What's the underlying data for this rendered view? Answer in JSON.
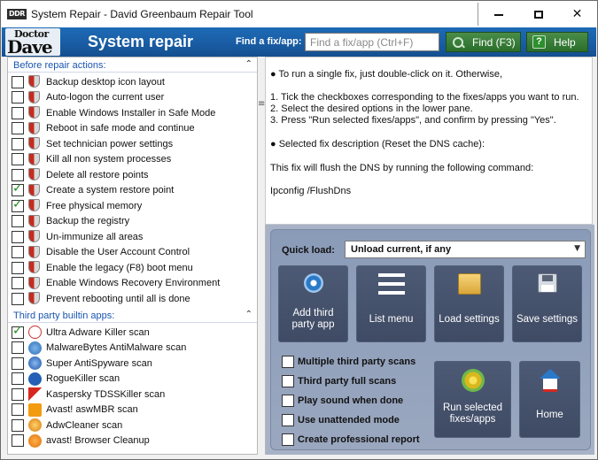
{
  "window": {
    "title": "System Repair - David Greenbaum Repair Tool",
    "icon_text": "DDR",
    "controls": {
      "minimize_icon": "minimize-icon",
      "maximize_icon": "maximize-icon",
      "close_glyph": "✕"
    }
  },
  "header": {
    "logo_top": "Doctor",
    "logo_bottom": "Dave",
    "title": "System repair",
    "find_label": "Find a fix/app:",
    "search_placeholder": "Find a fix/app (Ctrl+F)",
    "find_button": "Find (F3)",
    "help_button": "Help",
    "accent_color": "#1d6bb5",
    "button_color": "#2a6e2b"
  },
  "left": {
    "sections": [
      {
        "title": "Before repair actions:",
        "items": [
          {
            "label": "Backup desktop icon layout",
            "checked": false
          },
          {
            "label": "Auto-logon the current user",
            "checked": false
          },
          {
            "label": "Enable Windows Installer in Safe Mode",
            "checked": false
          },
          {
            "label": "Reboot in safe mode and continue",
            "checked": false
          },
          {
            "label": "Set technician power settings",
            "checked": false
          },
          {
            "label": "Kill all non system processes",
            "checked": false
          },
          {
            "label": "Delete all restore points",
            "checked": false
          },
          {
            "label": "Create a system restore point",
            "checked": true
          },
          {
            "label": "Free physical memory",
            "checked": true
          },
          {
            "label": "Backup the registry",
            "checked": false
          },
          {
            "label": "Un-immunize all areas",
            "checked": false
          },
          {
            "label": "Disable the User Account Control",
            "checked": false
          },
          {
            "label": "Enable the legacy (F8) boot menu",
            "checked": false
          },
          {
            "label": "Enable Windows Recovery Environment",
            "checked": false
          },
          {
            "label": "Prevent rebooting until all is done",
            "checked": false
          }
        ]
      },
      {
        "title": "Third party builtin apps:",
        "items": [
          {
            "label": "Ultra Adware Killer scan",
            "checked": true,
            "icon": "ultra-adware-killer-icon"
          },
          {
            "label": "MalwareBytes AntiMalware scan",
            "checked": false,
            "icon": "malwarebytes-icon"
          },
          {
            "label": "Super AntiSpyware scan",
            "checked": false,
            "icon": "superantispyware-icon"
          },
          {
            "label": "RogueKiller scan",
            "checked": false,
            "icon": "roguekiller-icon"
          },
          {
            "label": "Kaspersky TDSSKiller scan",
            "checked": false,
            "icon": "kaspersky-icon"
          },
          {
            "label": "Avast! aswMBR scan",
            "checked": false,
            "icon": "avast-icon"
          },
          {
            "label": "AdwCleaner scan",
            "checked": false,
            "icon": "adwcleaner-icon"
          },
          {
            "label": "avast! Browser Cleanup",
            "checked": false,
            "icon": "avast-browser-cleanup-icon"
          }
        ]
      }
    ]
  },
  "description": {
    "lines": [
      "● To run a single fix, just double-click on it. Otherwise,",
      "1. Tick the checkboxes corresponding to the fixes/apps you want to run.",
      "2. Select the desired options in the lower pane.",
      "3. Press \"Run selected fixes/apps\", and confirm by pressing \"Yes\".",
      "● Selected fix description (Reset the DNS cache):",
      "This fix will flush the DNS  by running the following command:",
      "Ipconfig /FlushDns"
    ]
  },
  "lower": {
    "quick_load_label": "Quick load:",
    "quick_load_value": "Unload current, if any",
    "tiles": {
      "add_third_party": "Add third party app",
      "list_menu": "List menu",
      "load_settings": "Load settings",
      "save_settings": "Save settings",
      "run_selected": "Run selected fixes/apps",
      "home": "Home"
    },
    "options": [
      {
        "label": "Multiple third party scans",
        "checked": false
      },
      {
        "label": "Third party full scans",
        "checked": false
      },
      {
        "label": "Play sound when done",
        "checked": false
      },
      {
        "label": "Use unattended mode",
        "checked": false
      },
      {
        "label": "Create professional report",
        "checked": false
      }
    ]
  }
}
